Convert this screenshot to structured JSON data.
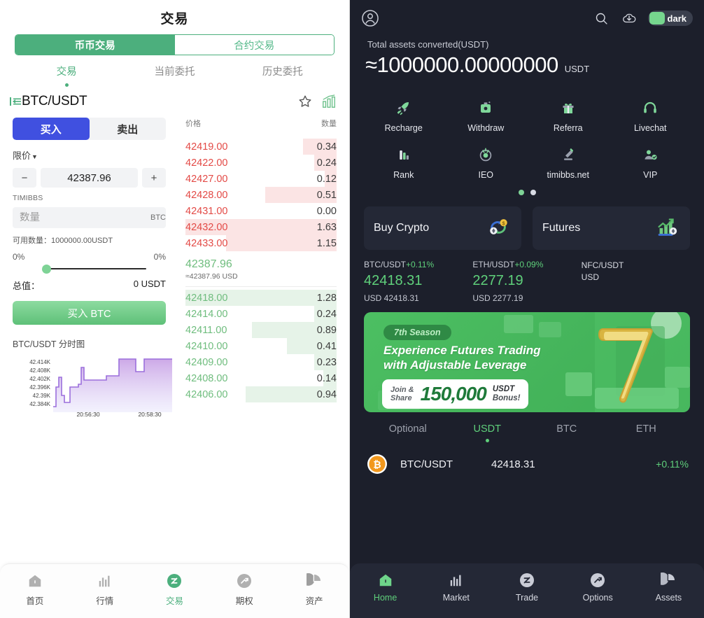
{
  "left": {
    "title": "交易",
    "segments": [
      {
        "label": "币币交易",
        "active": true
      },
      {
        "label": "合约交易",
        "active": false
      }
    ],
    "subtabs": [
      {
        "label": "交易",
        "active": true
      },
      {
        "label": "当前委托",
        "active": false
      },
      {
        "label": "历史委托",
        "active": false
      }
    ],
    "pair": "BTC/USDT",
    "icons": {
      "collapse": "collapse-icon",
      "favorite": "star-icon",
      "kline": "chart-bars-icon"
    },
    "form": {
      "buy_label": "买入",
      "sell_label": "卖出",
      "order_type": "限价",
      "minus": "−",
      "plus": "+",
      "price_value": "42387.96",
      "brand_label": "TIMIBBS",
      "amount_placeholder": "数量",
      "amount_unit": "BTC",
      "available_label": "可用数量：1000000.00USDT",
      "pct_left": "0%",
      "pct_right": "0%",
      "total_label": "总值：",
      "total_value": "0 USDT",
      "cta_label": "买入 BTC"
    },
    "orderbook": {
      "col_price": "价格",
      "col_amount": "数量",
      "asks": [
        {
          "price": "42419.00",
          "amount": "0.34",
          "bar": 22
        },
        {
          "price": "42422.00",
          "amount": "0.24",
          "bar": 15
        },
        {
          "price": "42427.00",
          "amount": "0.12",
          "bar": 8
        },
        {
          "price": "42428.00",
          "amount": "0.51",
          "bar": 47
        },
        {
          "price": "42431.00",
          "amount": "0.00",
          "bar": 0
        },
        {
          "price": "42432.00",
          "amount": "1.63",
          "bar": 100
        },
        {
          "price": "42433.00",
          "amount": "1.15",
          "bar": 73
        }
      ],
      "mid_price": "42387.96",
      "mid_sub": "≈42387.96 USD",
      "bids": [
        {
          "price": "42418.00",
          "amount": "1.28",
          "bar": 100
        },
        {
          "price": "42414.00",
          "amount": "0.24",
          "bar": 15
        },
        {
          "price": "42411.00",
          "amount": "0.89",
          "bar": 56
        },
        {
          "price": "42410.00",
          "amount": "0.41",
          "bar": 33
        },
        {
          "price": "42409.00",
          "amount": "0.23",
          "bar": 15
        },
        {
          "price": "42408.00",
          "amount": "0.14",
          "bar": 9
        },
        {
          "price": "42406.00",
          "amount": "0.94",
          "bar": 60
        }
      ]
    },
    "nav": [
      {
        "label": "首页",
        "icon": "home-icon",
        "active": false
      },
      {
        "label": "行情",
        "icon": "market-bars-icon",
        "active": false
      },
      {
        "label": "交易",
        "icon": "trade-icon",
        "active": true
      },
      {
        "label": "期权",
        "icon": "options-icon",
        "active": false
      },
      {
        "label": "资产",
        "icon": "assets-pie-icon",
        "active": false
      }
    ]
  },
  "chart_data": {
    "type": "line",
    "title": "BTC/USDT 分时图",
    "xlabel": "",
    "ylabel": "",
    "x_ticks": [
      "20:56:30",
      "20:58:30"
    ],
    "y_ticks": [
      "42.384K",
      "42.39K",
      "42.396K",
      "42.402K",
      "42.408K",
      "42.414K"
    ],
    "ylim": [
      42384,
      42416
    ],
    "grid": false,
    "line_color": "#9b6fdc",
    "fill_gradient": [
      "#cfa7e8",
      "#e9e6fb"
    ],
    "values": [
      42384,
      42389,
      42393,
      42388,
      42386,
      42391,
      42391,
      42392,
      42392,
      42404,
      42400,
      42400,
      42400,
      42400,
      42400,
      42403,
      42403,
      42403,
      42403,
      42414,
      42414,
      42414,
      42407,
      42407,
      42414,
      42414,
      42414
    ]
  },
  "right": {
    "header": {
      "avatar": "user-avatar-icon",
      "search": "search-icon",
      "download": "download-cloud-icon",
      "theme_label": "dark"
    },
    "assets": {
      "label": "Total assets converted(USDT)",
      "value": "≈1000000.00000000",
      "unit": "USDT"
    },
    "quick_actions": [
      {
        "label": "Recharge",
        "icon": "rocket-icon"
      },
      {
        "label": "Withdraw",
        "icon": "safe-box-icon"
      },
      {
        "label": "Referra",
        "icon": "gift-icon"
      },
      {
        "label": "Livechat",
        "icon": "headset-icon"
      },
      {
        "label": "Rank",
        "icon": "rank-bars-icon"
      },
      {
        "label": "IEO",
        "icon": "ieo-target-icon"
      },
      {
        "label": "timibbs.net",
        "icon": "gavel-icon"
      },
      {
        "label": "VIP",
        "icon": "vip-user-icon"
      }
    ],
    "page_dots": {
      "active_index": 0,
      "count": 2
    },
    "cards": [
      {
        "title": "Buy Crypto",
        "icon": "buy-crypto-icon"
      },
      {
        "title": "Futures",
        "icon": "futures-chart-icon"
      }
    ],
    "tickers": [
      {
        "pair": "BTC/USDT",
        "change": "+0.11%",
        "price": "42418.31",
        "usd": "USD 42418.31"
      },
      {
        "pair": "ETH/USDT",
        "change": "+0.09%",
        "price": "2277.19",
        "usd": "USD 2277.19"
      },
      {
        "pair": "NFC/USDT",
        "change": "",
        "price": "",
        "usd": "USD"
      }
    ],
    "banner": {
      "season": "7th Season",
      "headline_1": "Experience Futures Trading",
      "headline_2": "with Adjustable Leverage",
      "join": "Join &",
      "share": "Share",
      "amount": "150,000",
      "usdt": "USDT",
      "bonus": "Bonus!"
    },
    "market_tabs": [
      {
        "label": "Optional",
        "active": false
      },
      {
        "label": "USDT",
        "active": true
      },
      {
        "label": "BTC",
        "active": false
      },
      {
        "label": "ETH",
        "active": false
      }
    ],
    "market_rows": [
      {
        "icon": "bitcoin-icon",
        "pair": "BTC/USDT",
        "price": "42418.31",
        "change": "+0.11%"
      }
    ],
    "nav": [
      {
        "label": "Home",
        "icon": "home-icon",
        "active": true
      },
      {
        "label": "Market",
        "icon": "market-bars-icon",
        "active": false
      },
      {
        "label": "Trade",
        "icon": "trade-icon",
        "active": false
      },
      {
        "label": "Options",
        "icon": "options-icon",
        "active": false
      },
      {
        "label": "Assets",
        "icon": "assets-pie-icon",
        "active": false
      }
    ]
  },
  "colors": {
    "green": "#4caf7d",
    "green_bright": "#5fd07b",
    "blue": "#4050e0",
    "red": "#e34a46",
    "dark_bg": "#1c1f2b",
    "card_bg": "#242836"
  }
}
